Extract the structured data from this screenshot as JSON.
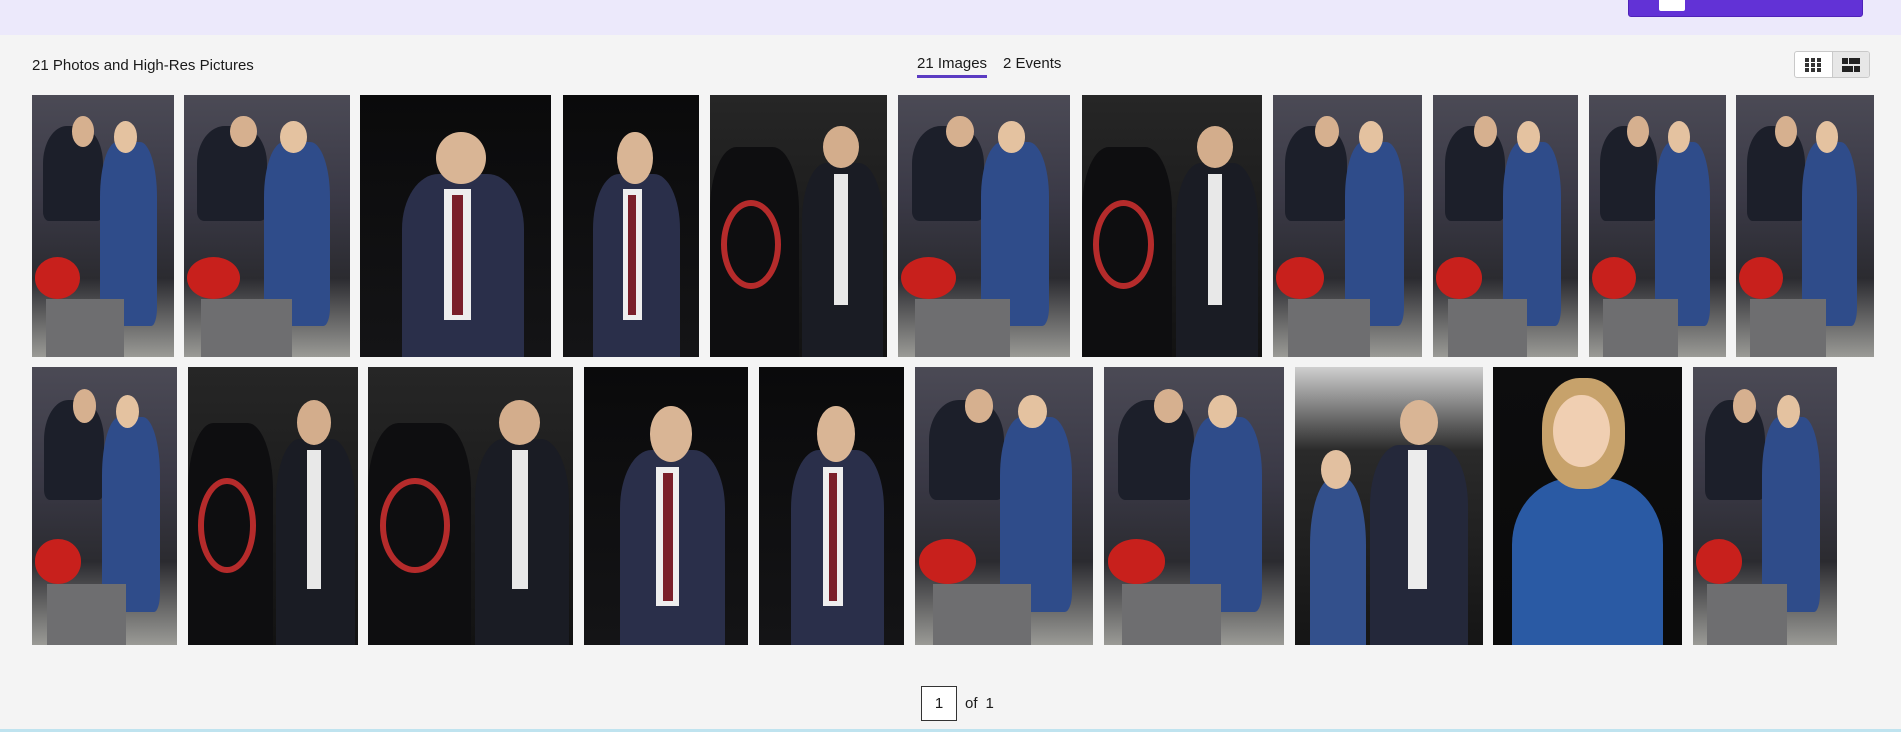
{
  "results": {
    "count_label": "21 Photos and High-Res Pictures"
  },
  "tabs": [
    {
      "label": "21 Images",
      "active": true
    },
    {
      "label": "2 Events",
      "active": false
    }
  ],
  "view_toggle": {
    "grid_icon": "grid-icon",
    "mosaic_icon": "mosaic-icon",
    "active": "mosaic"
  },
  "gallery": {
    "row1": [
      {
        "scene": "motorcycle-pair",
        "description_icon": "photo"
      },
      {
        "scene": "motorcycle-pair"
      },
      {
        "scene": "portrait-dark"
      },
      {
        "scene": "portrait-dark"
      },
      {
        "scene": "jacket-pair"
      },
      {
        "scene": "motorcycle-pair"
      },
      {
        "scene": "jacket-pair"
      },
      {
        "scene": "motorcycle-pair"
      },
      {
        "scene": "motorcycle-pair"
      },
      {
        "scene": "motorcycle-pair"
      },
      {
        "scene": "motorcycle-pair"
      }
    ],
    "row2": [
      {
        "scene": "motorcycle-pair"
      },
      {
        "scene": "jacket-pair"
      },
      {
        "scene": "jacket-pair"
      },
      {
        "scene": "portrait-dark"
      },
      {
        "scene": "portrait-dark"
      },
      {
        "scene": "motorcycle-pair"
      },
      {
        "scene": "motorcycle-pair"
      },
      {
        "scene": "group-dark"
      },
      {
        "scene": "girl-denim"
      },
      {
        "scene": "motorcycle-pair"
      }
    ]
  },
  "pagination": {
    "current": "1",
    "of_label": "of",
    "total": "1"
  },
  "colors": {
    "accent": "#5b3bc2",
    "topbar": "#ece9fb",
    "button": "#6232d6"
  }
}
